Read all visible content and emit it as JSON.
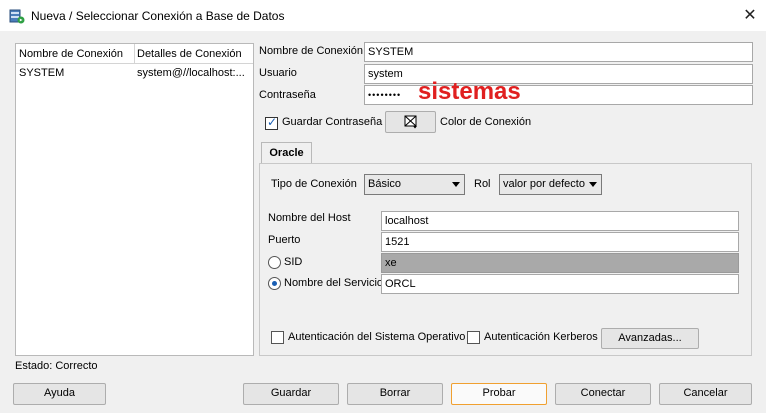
{
  "window": {
    "title": "Nueva / Seleccionar Conexión a Base de Datos",
    "close_label": "✕"
  },
  "connections": {
    "headers": [
      "Nombre de Conexión",
      "Detalles de Conexión"
    ],
    "rows": [
      {
        "name": "SYSTEM",
        "details": "system@//localhost:..."
      }
    ]
  },
  "form": {
    "connection_name_label": "Nombre de Conexión",
    "connection_name_value": "SYSTEM",
    "user_label": "Usuario",
    "user_value": "system",
    "password_label": "Contraseña",
    "password_value": "••••••••",
    "annotation": "sistemas",
    "save_password_label": "Guardar Contraseña",
    "save_password_checked": true,
    "connection_color_label": "Color de Conexión"
  },
  "oracle_tab": {
    "tab_label": "Oracle",
    "connection_type_label": "Tipo de Conexión",
    "connection_type_value": "Básico",
    "role_label": "Rol",
    "role_value": "valor por defecto",
    "host_label": "Nombre del Host",
    "host_value": "localhost",
    "port_label": "Puerto",
    "port_value": "1521",
    "sid_label": "SID",
    "sid_value": "xe",
    "service_label": "Nombre del Servicio",
    "service_value": "ORCL",
    "os_auth_label": "Autenticación del Sistema Operativo",
    "kerberos_label": "Autenticación Kerberos",
    "advanced_label": "Avanzadas..."
  },
  "status": "Estado: Correcto",
  "buttons": {
    "help": "Ayuda",
    "save": "Guardar",
    "delete": "Borrar",
    "test": "Probar",
    "connect": "Conectar",
    "cancel": "Cancelar"
  },
  "colors": {
    "annotation": "#e02020",
    "accent": "#1a5fb4",
    "focus_border": "#f0a030"
  }
}
